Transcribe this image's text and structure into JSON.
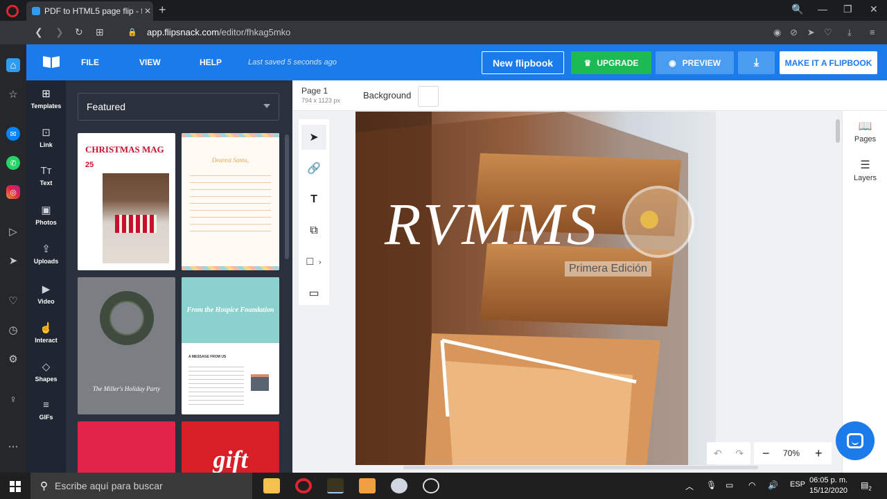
{
  "browser": {
    "tab_title": "PDF to HTML5 page flip - fl",
    "tab_close": "✕",
    "new_tab": "+",
    "url_domain": "app.flipsnack.com",
    "url_path": "/editor/fhkag5mko",
    "window_controls": [
      "🔍",
      "—",
      "❐",
      "✕"
    ]
  },
  "opera_sidebar": {
    "items": [
      "home",
      "bookmarks",
      "messenger",
      "whatsapp",
      "instagram",
      "player",
      "send",
      "heart",
      "history",
      "settings",
      "ideas",
      "more"
    ]
  },
  "header": {
    "menu": [
      "FILE",
      "VIEW",
      "HELP"
    ],
    "saved_status": "Last saved 5 seconds ago",
    "new_flipbook": "New flipbook",
    "upgrade": "UPGRADE",
    "preview": "PREVIEW",
    "make_flipbook": "MAKE IT A FLIPBOOK",
    "accent_color": "#1c7bea"
  },
  "left_nav": [
    {
      "label": "Templates",
      "icon": "templates-icon"
    },
    {
      "label": "Link",
      "icon": "link-icon"
    },
    {
      "label": "Text",
      "icon": "text-icon"
    },
    {
      "label": "Photos",
      "icon": "photos-icon"
    },
    {
      "label": "Uploads",
      "icon": "uploads-icon"
    },
    {
      "label": "Video",
      "icon": "video-icon"
    },
    {
      "label": "Interact",
      "icon": "interact-icon"
    },
    {
      "label": "Shapes",
      "icon": "shapes-icon"
    },
    {
      "label": "GIFs",
      "icon": "gifs-icon"
    }
  ],
  "templates": {
    "filter": "Featured",
    "items": [
      {
        "title": "CHRISTMAS MAG",
        "subtitle": "25"
      },
      {
        "title": "Dearest Santa,"
      },
      {
        "title": "The Miller's Holiday Party"
      },
      {
        "title": "From the Hospice Foundation",
        "subtitle": "A MESSAGE FROM US"
      },
      {
        "title": ""
      },
      {
        "title": "gift"
      }
    ]
  },
  "editor": {
    "page_name": "Page 1",
    "page_size": "794 x 1123 px",
    "background_label": "Background",
    "canvas_title": "RVMMS",
    "canvas_subtitle": "Primera Edición",
    "zoom": "70%"
  },
  "right_panel": {
    "pages": "Pages",
    "layers": "Layers"
  },
  "taskbar": {
    "search_placeholder": "Escribe aquí para buscar",
    "language": "ESP",
    "time": "06:05 p. m.",
    "date": "15/12/2020",
    "notifications": "2"
  }
}
